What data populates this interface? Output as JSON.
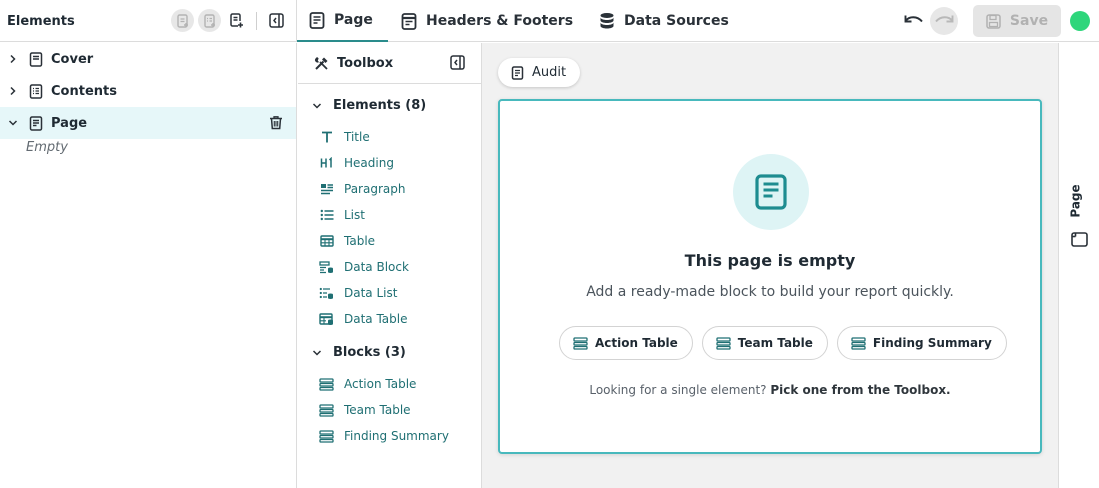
{
  "elements_panel": {
    "title": "Elements",
    "tree": [
      {
        "label": "Cover",
        "expanded": false
      },
      {
        "label": "Contents",
        "expanded": false
      },
      {
        "label": "Page",
        "expanded": true,
        "selected": true
      }
    ],
    "empty_note": "Empty"
  },
  "tabs": [
    {
      "label": "Page",
      "active": true,
      "icon": "page-icon"
    },
    {
      "label": "Headers & Footers",
      "active": false,
      "icon": "header-footer-icon"
    },
    {
      "label": "Data Sources",
      "active": false,
      "icon": "database-icon"
    }
  ],
  "actions": {
    "save_label": "Save",
    "status_color": "#2ed67b"
  },
  "toolbox": {
    "title": "Toolbox",
    "elements_heading": "Elements (8)",
    "elements": [
      {
        "label": "Title",
        "icon": "title-icon"
      },
      {
        "label": "Heading",
        "icon": "heading-icon"
      },
      {
        "label": "Paragraph",
        "icon": "paragraph-icon"
      },
      {
        "label": "List",
        "icon": "list-icon"
      },
      {
        "label": "Table",
        "icon": "table-icon"
      },
      {
        "label": "Data Block",
        "icon": "data-block-icon"
      },
      {
        "label": "Data List",
        "icon": "data-list-icon"
      },
      {
        "label": "Data Table",
        "icon": "data-table-icon"
      }
    ],
    "blocks_heading": "Blocks (3)",
    "blocks": [
      {
        "label": "Action Table",
        "icon": "block-icon"
      },
      {
        "label": "Team Table",
        "icon": "block-icon"
      },
      {
        "label": "Finding Summary",
        "icon": "block-icon"
      }
    ]
  },
  "canvas": {
    "audit_label": "Audit",
    "empty_title": "This page is empty",
    "empty_subtitle": "Add a ready-made block to build your report quickly.",
    "quick_blocks": [
      "Action Table",
      "Team Table",
      "Finding Summary"
    ],
    "hint_prefix": "Looking for a single element?",
    "hint_link": "Pick one from the Toolbox."
  },
  "rail": {
    "label": "Page"
  },
  "colors": {
    "accent": "#2a8c8c",
    "link": "#1f6f73",
    "card_border": "#48b9bd"
  }
}
